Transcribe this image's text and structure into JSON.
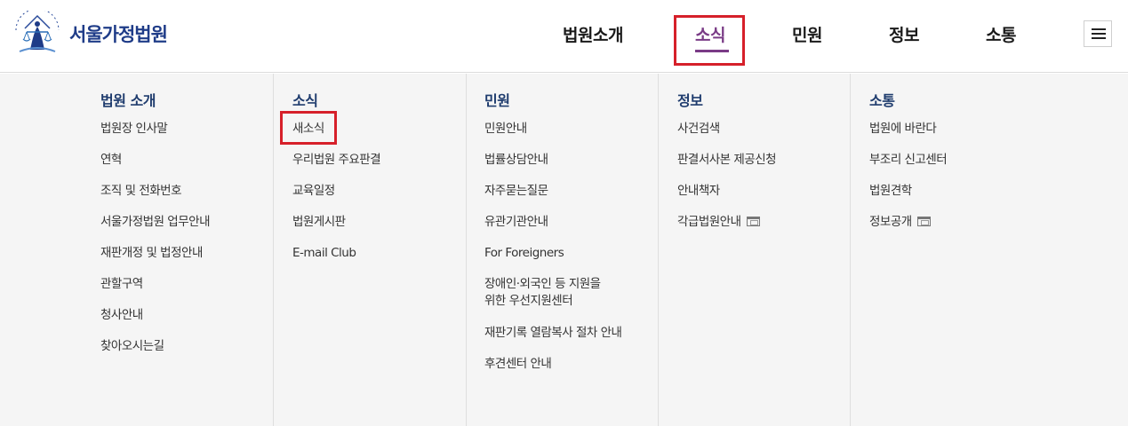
{
  "header": {
    "logo_text": "서울가정법원",
    "nav": [
      "법원소개",
      "소식",
      "민원",
      "정보",
      "소통"
    ],
    "active_nav": "소식"
  },
  "menu": [
    {
      "title": "법원 소개",
      "items": [
        "법원장 인사말",
        "연혁",
        "조직 및 전화번호",
        "서울가정법원 업무안내",
        "재판개정 및 법정안내",
        "관할구역",
        "청사안내",
        "찾아오시는길"
      ]
    },
    {
      "title": "소식",
      "items": [
        "새소식",
        "우리법원 주요판결",
        "교육일정",
        "법원게시판",
        "E-mail Club"
      ]
    },
    {
      "title": "민원",
      "items": [
        "민원안내",
        "법률상담안내",
        "자주묻는질문",
        "유관기관안내",
        "For Foreigners",
        "장애인·외국인 등 지원을",
        "위한 우선지원센터",
        "재판기록 열람복사 절차 안내",
        "후견센터 안내"
      ]
    },
    {
      "title": "정보",
      "items": [
        "사건검색",
        "판결서사본 제공신청",
        "안내책자",
        "각급법원안내"
      ]
    },
    {
      "title": "소통",
      "items": [
        "법원에 바란다",
        "부조리 신고센터",
        "법원견학",
        "정보공개"
      ]
    }
  ],
  "colors": {
    "brand": "#1f3c88",
    "active": "#7a3b86",
    "highlight": "#d6202a"
  }
}
